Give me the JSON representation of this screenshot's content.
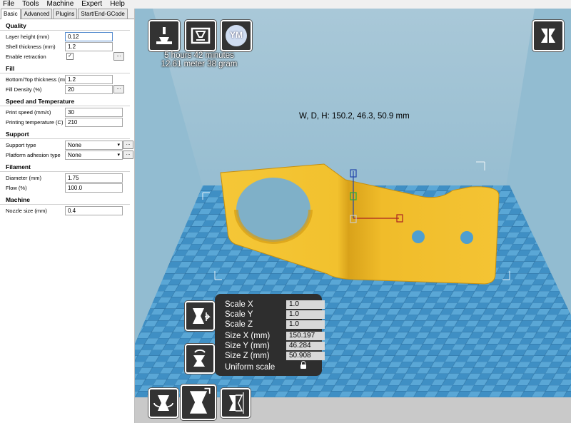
{
  "menu": [
    "File",
    "Tools",
    "Machine",
    "Expert",
    "Help"
  ],
  "tabs": [
    {
      "label": "Basic",
      "active": true
    },
    {
      "label": "Advanced",
      "active": false
    },
    {
      "label": "Plugins",
      "active": false
    },
    {
      "label": "Start/End-GCode",
      "active": false
    }
  ],
  "sections": {
    "quality": "Quality",
    "fill": "Fill",
    "speed": "Speed and Temperature",
    "support": "Support",
    "filament": "Filament",
    "machine": "Machine"
  },
  "fields": {
    "layer_height": {
      "label": "Layer height (mm)",
      "value": "0.12"
    },
    "shell_thickness": {
      "label": "Shell thickness (mm)",
      "value": "1.2"
    },
    "enable_retraction": {
      "label": "Enable retraction",
      "checked": true
    },
    "bottom_top": {
      "label": "Bottom/Top thickness (mm)",
      "value": "1.2"
    },
    "fill_density": {
      "label": "Fill Density (%)",
      "value": "20"
    },
    "print_speed": {
      "label": "Print speed (mm/s)",
      "value": "30"
    },
    "print_temp": {
      "label": "Printing temperature (C)",
      "value": "210"
    },
    "support_type": {
      "label": "Support type",
      "value": "None"
    },
    "adhesion_type": {
      "label": "Platform adhesion type",
      "value": "None"
    },
    "diameter": {
      "label": "Diameter (mm)",
      "value": "1.75"
    },
    "flow": {
      "label": "Flow (%)",
      "value": "100.0"
    },
    "nozzle": {
      "label": "Nozzle size (mm)",
      "value": "0.4"
    }
  },
  "dots_label": "...",
  "checkmark": "✓",
  "dropdown_arrow": "▾",
  "toolbar": {
    "ym_label": "YM"
  },
  "print_info": {
    "time": "5 hours 42 minutes",
    "material": "12.61 meter 38 gram"
  },
  "dimensions": "W, D, H: 150.2, 46.3, 50.9 mm",
  "scale_panel": {
    "rows": [
      {
        "label": "Scale X",
        "value": "1.0"
      },
      {
        "label": "Scale Y",
        "value": "1.0"
      },
      {
        "label": "Scale Z",
        "value": "1.0"
      },
      {
        "label": "Size X (mm)",
        "value": "150.197"
      },
      {
        "label": "Size Y (mm)",
        "value": "46.284"
      },
      {
        "label": "Size Z (mm)",
        "value": "50.908"
      }
    ],
    "uniform": "Uniform scale"
  },
  "icons": {
    "load": "load-model-icon",
    "sd": "save-gcode-icon",
    "ym": "ym-plugin-icon",
    "view": "view-mode-icon",
    "scale_max": "scale-max-icon",
    "mirror": "mirror-icon",
    "rotate": "rotate-icon",
    "scale": "scale-icon",
    "mirror_tool": "mirror-tool-icon"
  },
  "colors": {
    "model": "#f2c12e",
    "sky": "#8fb7cc",
    "bed": "#4f9fcf",
    "panel": "#2e2e2e"
  }
}
